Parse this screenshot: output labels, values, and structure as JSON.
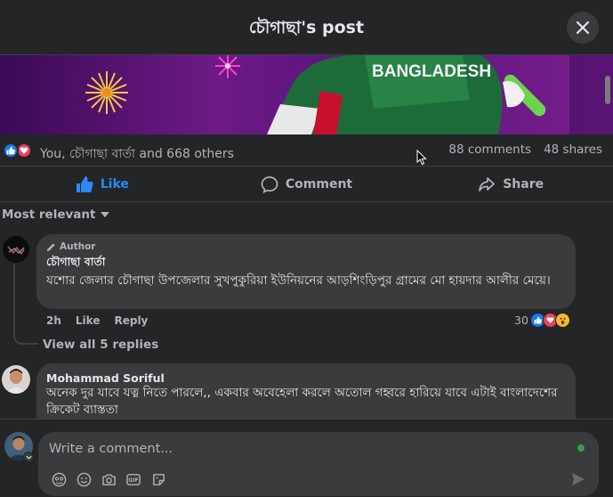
{
  "header": {
    "title": "চৌগাছা's post"
  },
  "image": {
    "jersey_text": "BANGLADESH"
  },
  "stats": {
    "reactors": "You, চৌগাছা বার্তা and 668 others",
    "comments": "88 comments",
    "shares": "48 shares"
  },
  "actions": {
    "like": "Like",
    "comment": "Comment",
    "share": "Share"
  },
  "sort": {
    "label": "Most relevant"
  },
  "comments": [
    {
      "badge": "Author",
      "name": "চৌগাছা বার্তা",
      "text": "যশোর জেলার চৌগাছা উপজেলার সুখপুকুরিয়া ইউনিয়নের আড়শিংড়িপুর গ্রামের মো হায়দার আলীর মেয়ে।",
      "time": "2h",
      "like": "Like",
      "reply": "Reply",
      "reaction_count": "30",
      "view_replies": "View all 5 replies"
    },
    {
      "name": "Mohammad Soriful",
      "text": "অনেক দুর যাবে যত্ন নিতে পারলে,, একবার অবেহেলা করলে অতোল গহ্বরে হারিয়ে যাবে এটাই বাংলাদেশের ক্রিকেট ব্যাস্ততা"
    }
  ],
  "composer": {
    "placeholder": "Write a comment..."
  },
  "colors": {
    "like_blue": "#2d88ff",
    "love_red": "#f33e58",
    "online_green": "#31a24c"
  }
}
